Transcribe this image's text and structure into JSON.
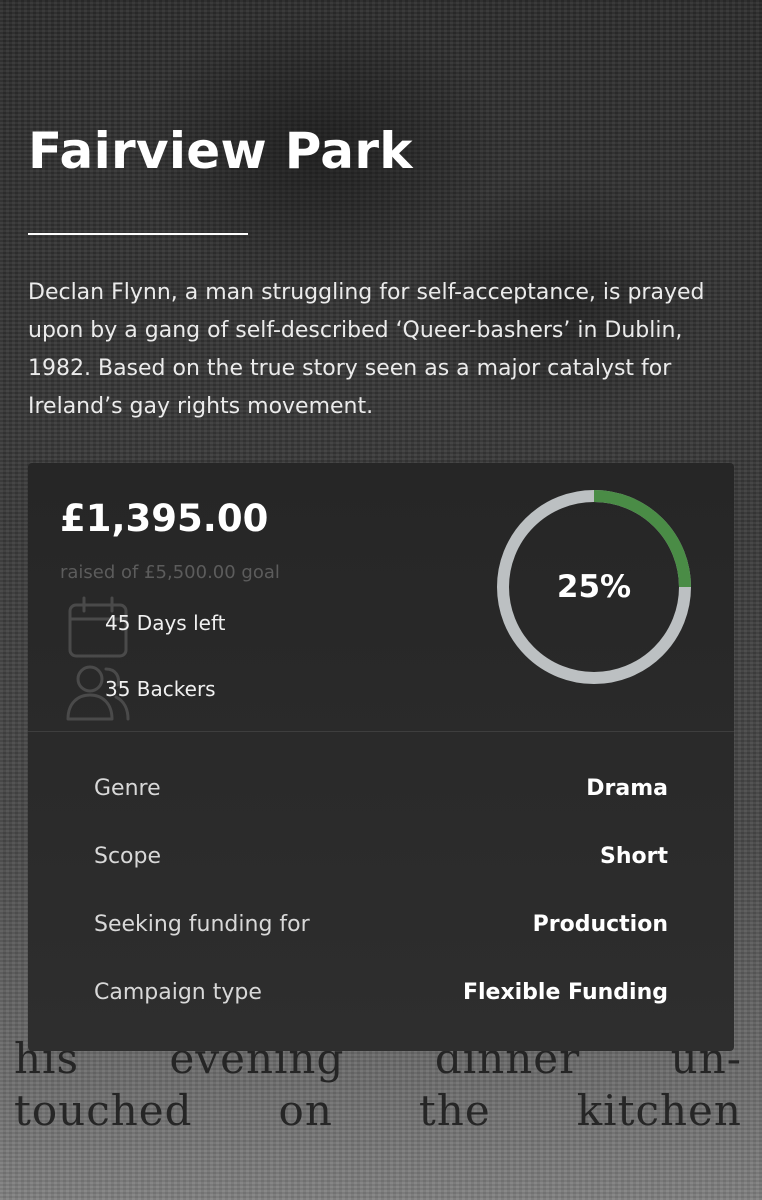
{
  "project": {
    "title": "Fairview Park",
    "description": "Declan Flynn, a man struggling for self-acceptance, is prayed upon by a gang of self-described ‘Queer-bashers’ in Dublin, 1982. Based on the true story seen as a major catalyst for Ireland’s gay rights movement."
  },
  "background": {
    "newspaper_line_1": [
      "his",
      "evening",
      "dinner",
      "un-"
    ],
    "newspaper_line_2": [
      "touched",
      "on",
      "the",
      "kitchen"
    ]
  },
  "funding": {
    "raised": "£1,395.00",
    "goal_text": "raised of £5,500.00 goal",
    "days_left": "45 Days left",
    "backers": "35 Backers",
    "percent_label": "25%",
    "percent_value": 0.25,
    "ring_color": "#bcc0c2",
    "progress_color": "#4a8c46",
    "icons": [
      "calendar-icon",
      "backers-icon"
    ]
  },
  "details": [
    {
      "label": "Genre",
      "value": "Drama"
    },
    {
      "label": "Scope",
      "value": "Short"
    },
    {
      "label": "Seeking funding for",
      "value": "Production"
    },
    {
      "label": "Campaign type",
      "value": "Flexible Funding"
    }
  ]
}
